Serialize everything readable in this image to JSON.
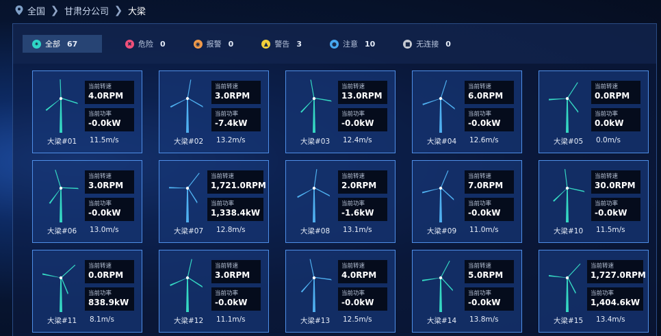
{
  "breadcrumb": {
    "items": [
      "全国",
      "甘肃分公司",
      "大梁"
    ]
  },
  "tabs": [
    {
      "label": "全部",
      "count": "67",
      "icon": "fan-icon",
      "color": "#2fd5c6"
    },
    {
      "label": "危险",
      "count": "0",
      "icon": "danger-icon",
      "color": "#ef4f7a"
    },
    {
      "label": "报警",
      "count": "0",
      "icon": "alarm-icon",
      "color": "#f09a4a"
    },
    {
      "label": "警告",
      "count": "3",
      "icon": "bell-icon",
      "color": "#f2cf3a"
    },
    {
      "label": "注意",
      "count": "10",
      "icon": "info-icon",
      "color": "#47a8f0"
    },
    {
      "label": "无连接",
      "count": "0",
      "icon": "disconnected-icon",
      "color": "#c7cbd3"
    }
  ],
  "stat_labels": {
    "speed": "当前转速",
    "power": "当前功率"
  },
  "colors": {
    "turbine_teal": "#35d8c3",
    "turbine_blue": "#4fb0f0"
  },
  "turbines": [
    {
      "name": "大梁#01",
      "speed": "4.0RPM",
      "power": "-0.0kW",
      "wind": "11.5m/s",
      "color": "teal"
    },
    {
      "name": "大梁#02",
      "speed": "3.0RPM",
      "power": "-7.4kW",
      "wind": "13.2m/s",
      "color": "blue"
    },
    {
      "name": "大梁#03",
      "speed": "13.0RPM",
      "power": "-0.0kW",
      "wind": "12.4m/s",
      "color": "teal"
    },
    {
      "name": "大梁#04",
      "speed": "6.0RPM",
      "power": "-0.0kW",
      "wind": "12.6m/s",
      "color": "blue"
    },
    {
      "name": "大梁#05",
      "speed": "0.0RPM",
      "power": "0.0kW",
      "wind": "0.0m/s",
      "color": "teal"
    },
    {
      "name": "大梁#06",
      "speed": "3.0RPM",
      "power": "-0.0kW",
      "wind": "13.0m/s",
      "color": "teal"
    },
    {
      "name": "大梁#07",
      "speed": "1,721.0RPM",
      "power": "1,338.4kW",
      "wind": "12.8m/s",
      "color": "blue"
    },
    {
      "name": "大梁#08",
      "speed": "2.0RPM",
      "power": "-1.6kW",
      "wind": "13.1m/s",
      "color": "blue"
    },
    {
      "name": "大梁#09",
      "speed": "7.0RPM",
      "power": "-0.0kW",
      "wind": "11.0m/s",
      "color": "blue"
    },
    {
      "name": "大梁#10",
      "speed": "30.0RPM",
      "power": "-0.0kW",
      "wind": "11.5m/s",
      "color": "teal"
    },
    {
      "name": "大梁#11",
      "speed": "0.0RPM",
      "power": "838.9kW",
      "wind": "8.1m/s",
      "color": "teal"
    },
    {
      "name": "大梁#12",
      "speed": "3.0RPM",
      "power": "-0.0kW",
      "wind": "11.1m/s",
      "color": "teal"
    },
    {
      "name": "大梁#13",
      "speed": "4.0RPM",
      "power": "-0.0kW",
      "wind": "12.5m/s",
      "color": "blue"
    },
    {
      "name": "大梁#14",
      "speed": "5.0RPM",
      "power": "-0.0kW",
      "wind": "13.8m/s",
      "color": "teal"
    },
    {
      "name": "大梁#15",
      "speed": "1,727.0RPM",
      "power": "1,404.6kW",
      "wind": "13.4m/s",
      "color": "teal"
    }
  ]
}
